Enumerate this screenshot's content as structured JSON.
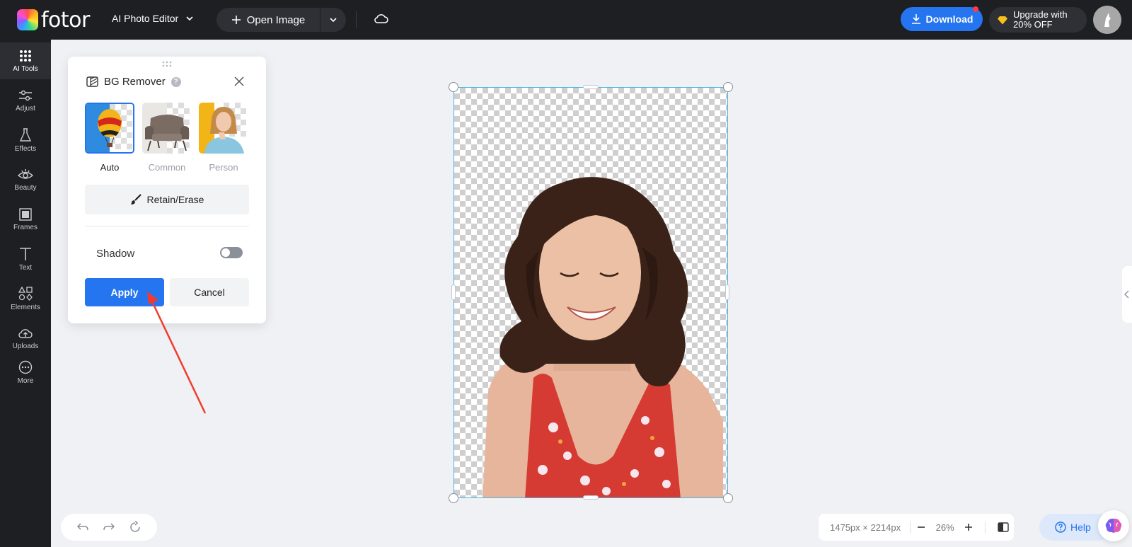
{
  "app": {
    "brand": "fotor",
    "editor_menu_label": "AI Photo Editor",
    "open_image_label": "Open Image",
    "download_label": "Download",
    "upgrade_line1": "Upgrade with",
    "upgrade_line2": "20% OFF"
  },
  "sidebar": {
    "items": [
      {
        "label": "AI Tools",
        "icon": "grid-dots-icon",
        "active": true
      },
      {
        "label": "Adjust",
        "icon": "sliders-icon"
      },
      {
        "label": "Effects",
        "icon": "flask-icon"
      },
      {
        "label": "Beauty",
        "icon": "eye-icon"
      },
      {
        "label": "Frames",
        "icon": "frame-icon"
      },
      {
        "label": "Text",
        "icon": "text-icon"
      },
      {
        "label": "Elements",
        "icon": "shapes-icon"
      },
      {
        "label": "Uploads",
        "icon": "cloud-upload-icon"
      },
      {
        "label": "More",
        "icon": "more-dots-icon"
      }
    ]
  },
  "bg_remover": {
    "title": "BG Remover",
    "modes": [
      {
        "label": "Auto",
        "selected": true
      },
      {
        "label": "Common",
        "selected": false
      },
      {
        "label": "Person",
        "selected": false
      }
    ],
    "retain_erase_label": "Retain/Erase",
    "shadow_label": "Shadow",
    "shadow_enabled": false,
    "apply_label": "Apply",
    "cancel_label": "Cancel"
  },
  "canvas": {
    "dimensions_text": "1475px × 2214px",
    "zoom_text": "26%"
  },
  "help_label": "Help",
  "colors": {
    "accent": "#2475ef",
    "topbar": "#1e1f23",
    "selection_border": "#49b6e8",
    "annotation_arrow": "#f23a2f"
  }
}
